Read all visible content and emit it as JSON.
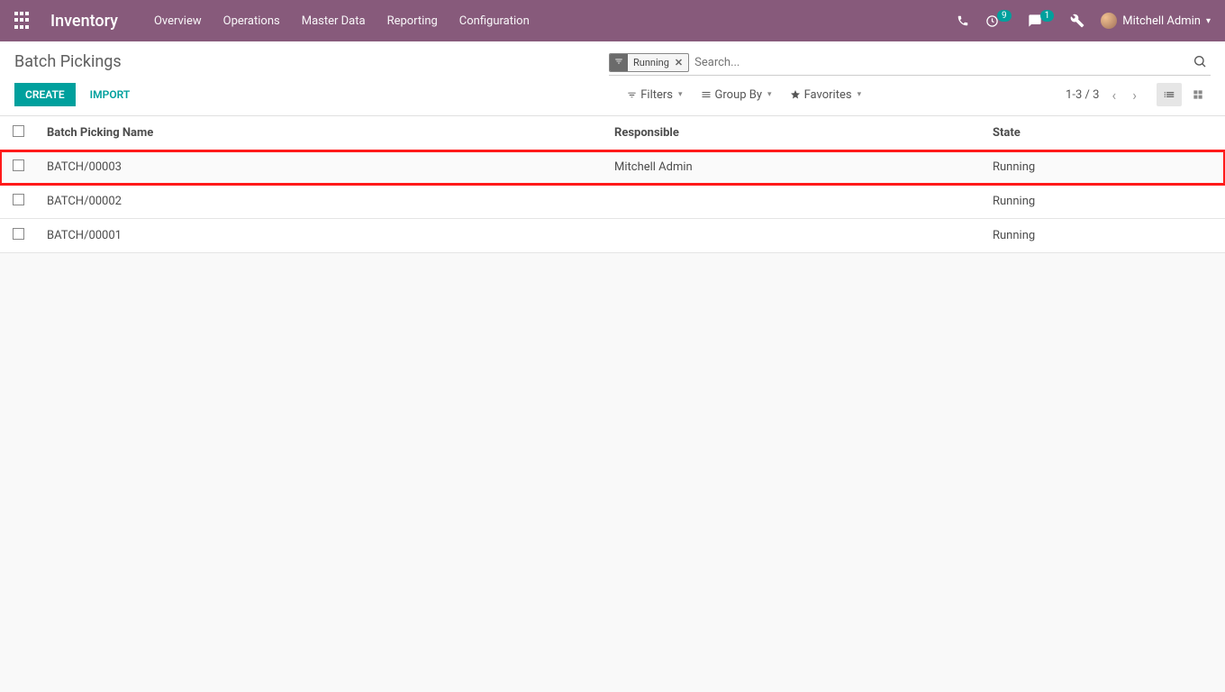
{
  "navbar": {
    "brand": "Inventory",
    "menu": [
      "Overview",
      "Operations",
      "Master Data",
      "Reporting",
      "Configuration"
    ],
    "notif_count": "9",
    "msg_count": "1",
    "user_name": "Mitchell Admin"
  },
  "page": {
    "title": "Batch Pickings",
    "create_label": "CREATE",
    "import_label": "IMPORT"
  },
  "search": {
    "chip_label": "Running",
    "placeholder": "Search..."
  },
  "toolbar": {
    "filters": "Filters",
    "groupby": "Group By",
    "favorites": "Favorites",
    "pager": "1-3 / 3"
  },
  "table": {
    "headers": {
      "name": "Batch Picking Name",
      "responsible": "Responsible",
      "state": "State"
    },
    "rows": [
      {
        "name": "BATCH/00003",
        "responsible": "Mitchell Admin",
        "state": "Running"
      },
      {
        "name": "BATCH/00002",
        "responsible": "",
        "state": "Running"
      },
      {
        "name": "BATCH/00001",
        "responsible": "",
        "state": "Running"
      }
    ]
  }
}
